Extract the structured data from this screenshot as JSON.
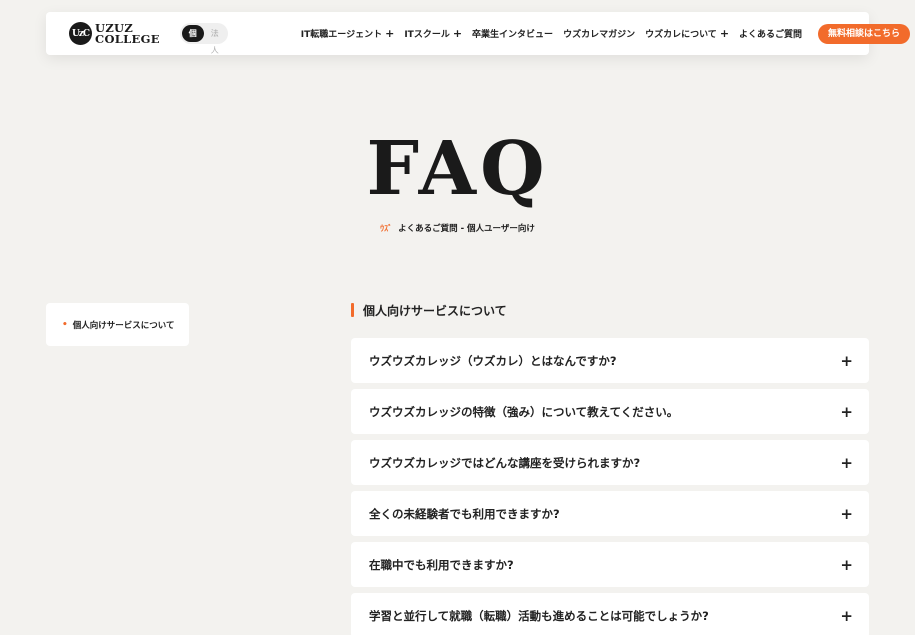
{
  "header": {
    "logo_mark": "UzC",
    "logo_line1": "UZUZ",
    "logo_line2": "COLLEGE",
    "segment": {
      "active": "個人",
      "inactive": "法人"
    },
    "nav": [
      {
        "label": "IT転職エージェント",
        "has_plus": true
      },
      {
        "label": "ITスクール",
        "has_plus": true
      },
      {
        "label": "卒業生インタビュー",
        "has_plus": false
      },
      {
        "label": "ウズカレマガジン",
        "has_plus": false
      },
      {
        "label": "ウズカレについて",
        "has_plus": true
      },
      {
        "label": "よくあるご質問",
        "has_plus": false
      }
    ],
    "plus_symbol": "+",
    "cta_label": "無料相談はこちら"
  },
  "hero": {
    "title": "FAQ",
    "breadcrumb_icon": "ｳｽﾞ",
    "breadcrumb": "よくあるご質問 - 個人ユーザー向け"
  },
  "sidebar": {
    "bullet": "•",
    "item_label": "個人向けサービスについて"
  },
  "section": {
    "title": "個人向けサービスについて",
    "faqs": [
      "ウズウズカレッジ（ウズカレ）とはなんですか?",
      "ウズウズカレッジの特徴（強み）について教えてください。",
      "ウズウズカレッジではどんな講座を受けられますか?",
      "全くの未経験者でも利用できますか?",
      "在職中でも利用できますか?",
      "学習と並行して就職（転職）活動も進めることは可能でしょうか?"
    ],
    "expand_symbol": "+"
  },
  "colors": {
    "accent": "#f26b2b",
    "background": "#f3f2ef",
    "dark": "#1a1a1a"
  }
}
